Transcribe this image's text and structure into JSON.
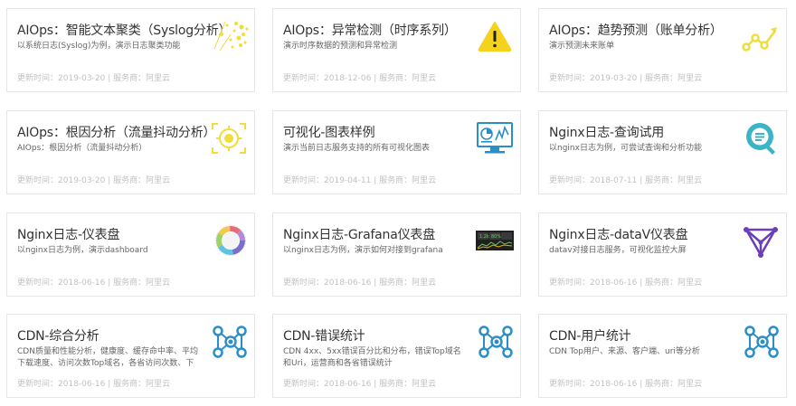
{
  "meta": {
    "update_prefix": "更新时间：",
    "separator": " | ",
    "provider_prefix": "服务商：",
    "provider": "阿里云"
  },
  "cards": [
    {
      "title": "AIOps：智能文本聚类（Syslog分析）",
      "desc": "以系统日志(Syslog)为例，演示日志聚类功能",
      "date": "2019-03-20",
      "icon": "scatter-cluster-icon"
    },
    {
      "title": "AIOps：异常检测（时序系列）",
      "desc": "演示时序数据的预测和异常检测",
      "date": "2018-12-06",
      "icon": "warning-icon"
    },
    {
      "title": "AIOps：趋势预测（账单分析）",
      "desc": "演示预测未来账单",
      "date": "2019-03-20",
      "icon": "trend-line-icon"
    },
    {
      "title": "AIOps：根因分析（流量抖动分析）",
      "desc": "AIOps：根因分析（流量抖动分析）",
      "date": "2019-03-20",
      "icon": "target-icon"
    },
    {
      "title": "可视化-图表样例",
      "desc": "演示当前日志服务支持的所有可视化图表",
      "date": "2019-04-11",
      "icon": "dashboard-monitor-icon"
    },
    {
      "title": "Nginx日志-查询试用",
      "desc": "以nginx日志为例，可尝试查询和分析功能",
      "date": "2018-07-11",
      "icon": "search-icon"
    },
    {
      "title": "Nginx日志-仪表盘",
      "desc": "以nginx日志为例，演示dashboard",
      "date": "2018-06-16",
      "icon": "donut-chart-icon"
    },
    {
      "title": "Nginx日志-Grafana仪表盘",
      "desc": "以nginx日志为例，演示如何对接到grafana",
      "date": "2018-06-16",
      "icon": "grafana-thumbnail-icon"
    },
    {
      "title": "Nginx日志-dataV仪表盘",
      "desc": "datav对接日志服务，可视化监控大屏",
      "date": "2018-06-16",
      "icon": "datav-triangle-icon"
    },
    {
      "title": "CDN-综合分析",
      "desc": "CDN质量和性能分析，健康度、缓存命中率、平均下载速度、访问次数Top域名，各省访问次数、下",
      "date": "2018-06-16",
      "icon": "network-nodes-icon"
    },
    {
      "title": "CDN-错误统计",
      "desc": "CDN 4xx、5xx错误百分比和分布，错误Top域名和Uri，运营商和各省错误统计",
      "date": "2018-06-16",
      "icon": "network-nodes-icon"
    },
    {
      "title": "CDN-用户统计",
      "desc": "CDN Top用户、来源、客户端、uri等分析",
      "date": "2018-06-16",
      "icon": "network-nodes-icon"
    }
  ]
}
